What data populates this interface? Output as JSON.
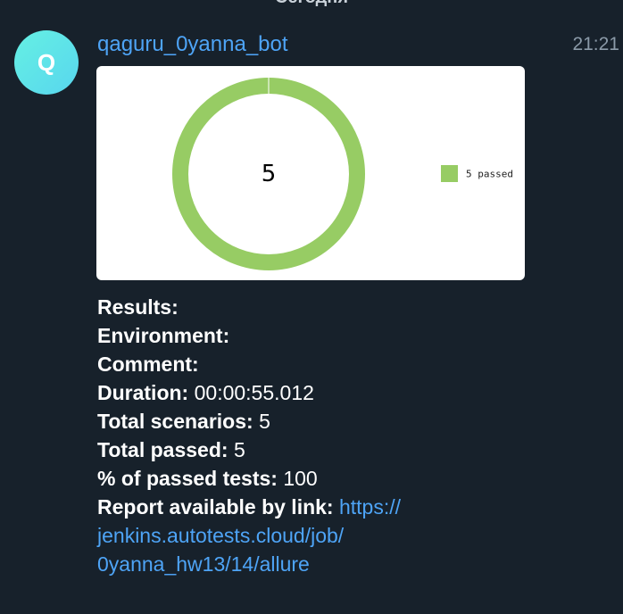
{
  "chat": {
    "date_divider": "Сегодня"
  },
  "message": {
    "avatar_letter": "Q",
    "avatar_color": "#5ee3ea",
    "sender": "qaguru_0yanna_bot",
    "time": "21:21",
    "results_label": "Results:",
    "environment_label": "Environment:",
    "comment_label": "Comment:",
    "duration_label": "Duration:",
    "duration_value": "00:00:55.012",
    "total_scenarios_label": "Total scenarios:",
    "total_scenarios_value": "5",
    "total_passed_label": "Total passed:",
    "total_passed_value": "5",
    "passed_percent_label": "% of passed tests:",
    "passed_percent_value": "100",
    "report_label": "Report available by link:",
    "report_link_line1": "https://",
    "report_link_line2": "jenkins.autotests.cloud/job/",
    "report_link_line3": "0yanna_hw13/14/allure"
  },
  "chart_data": {
    "type": "pie",
    "center_label": "5",
    "slices": [
      {
        "name": "5 passed",
        "value": 5,
        "color": "#97cc64"
      }
    ],
    "legend_position": "right"
  }
}
